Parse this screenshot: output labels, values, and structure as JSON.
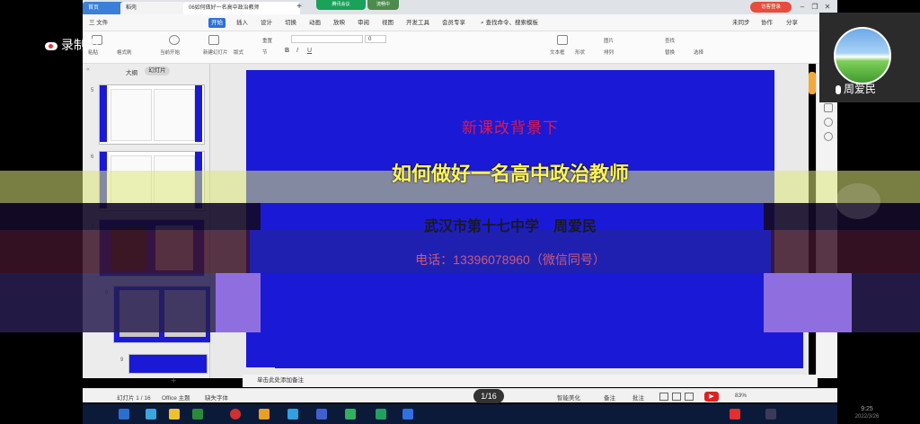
{
  "tabs": {
    "home": "首页",
    "daoke": "稻壳",
    "document": "06如何做好一名高中政治教师",
    "new_tab": "+"
  },
  "badges": {
    "meeting": "腾讯会议",
    "network": "流畅中"
  },
  "login": "访客登录",
  "menu": {
    "file": "三 文件",
    "items": [
      "开始",
      "插入",
      "设计",
      "切换",
      "动画",
      "放映",
      "审阅",
      "视图",
      "开发工具",
      "会员专享"
    ],
    "search": "查找命令、搜索模板",
    "sync": "未同步",
    "collab": "协作",
    "share": "分享"
  },
  "ribbon": {
    "paste": "粘贴",
    "format_painter": "格式刷",
    "play_from_current": "当前开始",
    "new_slide": "新建幻灯片",
    "layout": "版式",
    "section": "节",
    "reset": "重置",
    "textbox": "文本框",
    "shape": "形状",
    "picture": "图片",
    "arrange": "排列",
    "find": "查找",
    "replace": "替换",
    "select": "选择",
    "font_size": "0"
  },
  "recording": "录制中",
  "thumb_tabs": {
    "outline": "大纲",
    "slides": "幻灯片"
  },
  "thumb_numbers": [
    "5",
    "6",
    "7",
    "8",
    "9"
  ],
  "slide": {
    "subtitle": "新课改背景下",
    "title": "如何做好一名高中政治教师",
    "author": "武汉市第十七中学　周爱民",
    "phone": "电话：13396078960（微信同号）"
  },
  "notes_placeholder": "单击此处添加备注",
  "status": {
    "slide_count": "幻灯片 1 / 16",
    "theme": "Office 主题",
    "missing_font": "缺失字体",
    "page_indicator": "1/16",
    "smart_beautify": "智能美化",
    "notes": "备注",
    "comments": "批注",
    "zoom": "83%"
  },
  "participant": {
    "name": "周爱民"
  },
  "clock": {
    "time": "9:25",
    "date": "2022/3/26"
  },
  "colors": {
    "slide_background": "#1a1ad6",
    "title": "#fff55a",
    "subtitle": "#e0194a",
    "accent_tab": "#2f6fd6"
  }
}
